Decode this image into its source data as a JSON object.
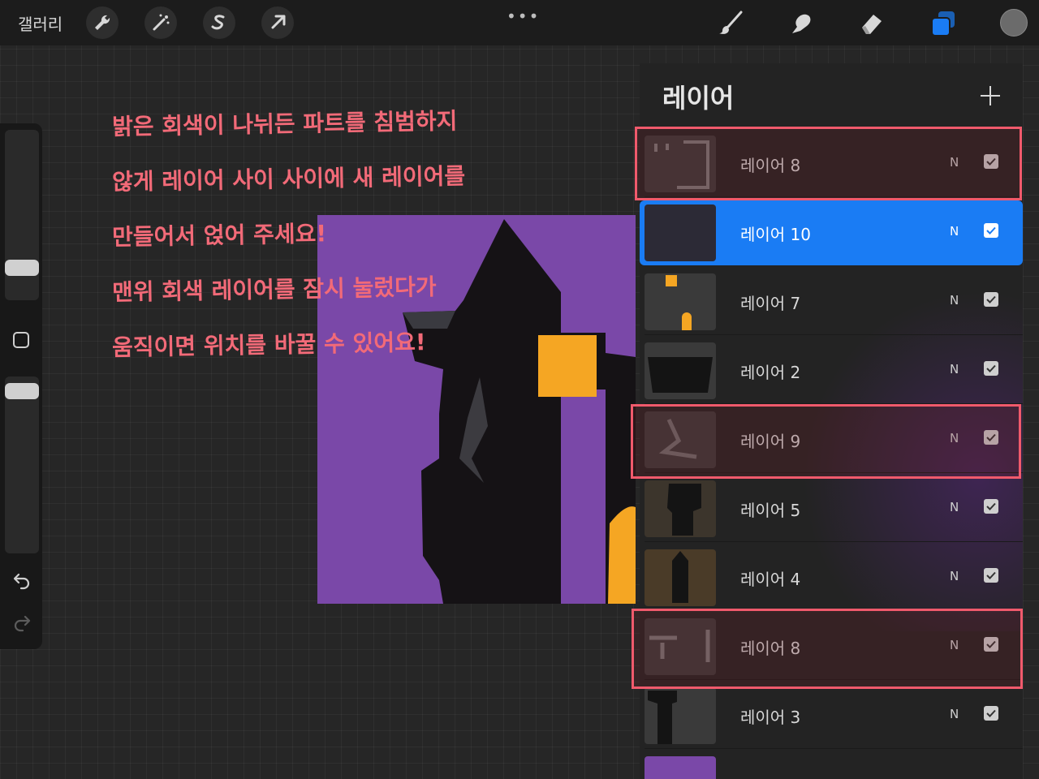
{
  "toolbar": {
    "gallery_label": "갤러리",
    "left_tools": [
      {
        "icon": "wrench-icon",
        "name": "actions"
      },
      {
        "icon": "magic-wand-icon",
        "name": "adjustments"
      },
      {
        "icon": "selection-s-icon",
        "name": "selection"
      },
      {
        "icon": "arrow-cursor-icon",
        "name": "transform"
      }
    ],
    "more_label": "•••",
    "right_tools": [
      {
        "icon": "brush-icon",
        "name": "paint"
      },
      {
        "icon": "smudge-finger-icon",
        "name": "smudge"
      },
      {
        "icon": "eraser-icon",
        "name": "erase"
      },
      {
        "icon": "layers-icon",
        "name": "layers",
        "active": true,
        "color": "#1a7cf4"
      }
    ],
    "current_color": "#6b6b6b"
  },
  "annotation": {
    "color": "#f26a78",
    "lines": [
      "밝은 회색이 나뉘든 파트를 침범하지",
      "않게 레이어 사이 사이에 새 레이어를",
      "만들어서 얹어 주세요!",
      "맨위 회색 레이어를 잠시 눌렀다가",
      "움직이면 위치를 바꿀 수 있어요!"
    ]
  },
  "artwork": {
    "background_color": "#7a48a8",
    "house_color": "#151215",
    "window_color": "#f5a623"
  },
  "layers_panel": {
    "title": "레이어",
    "add_icon": "plus-icon",
    "layers": [
      {
        "name": "레이어 8",
        "mode": "N",
        "visible": true,
        "active": false,
        "highlighted": true
      },
      {
        "name": "레이어 10",
        "mode": "N",
        "visible": true,
        "active": true,
        "highlighted": false
      },
      {
        "name": "레이어 7",
        "mode": "N",
        "visible": true,
        "active": false,
        "highlighted": false
      },
      {
        "name": "레이어 2",
        "mode": "N",
        "visible": true,
        "active": false,
        "highlighted": false
      },
      {
        "name": "레이어 9",
        "mode": "N",
        "visible": true,
        "active": false,
        "highlighted": true
      },
      {
        "name": "레이어 5",
        "mode": "N",
        "visible": true,
        "active": false,
        "highlighted": false
      },
      {
        "name": "레이어 4",
        "mode": "N",
        "visible": true,
        "active": false,
        "highlighted": false
      },
      {
        "name": "레이어 8",
        "mode": "N",
        "visible": true,
        "active": false,
        "highlighted": true
      },
      {
        "name": "레이어 3",
        "mode": "N",
        "visible": true,
        "active": false,
        "highlighted": false
      }
    ],
    "highlight_color": "#f05a6c"
  }
}
